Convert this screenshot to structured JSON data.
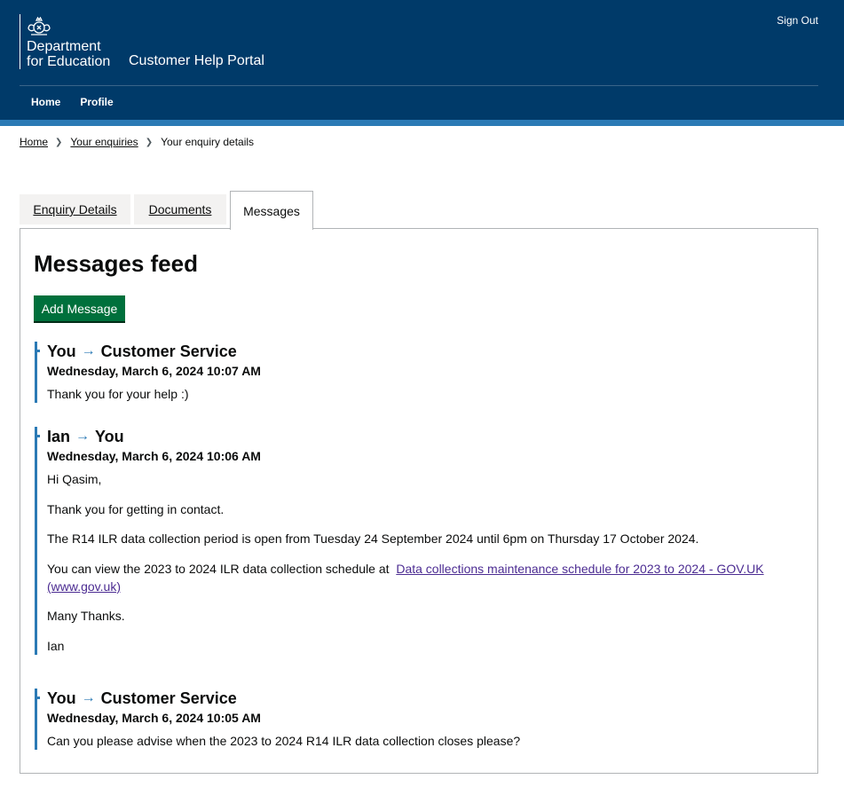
{
  "header": {
    "department_name": "Department\nfor Education",
    "portal_name": "Customer Help Portal",
    "sign_out": "Sign Out",
    "nav": [
      "Home",
      "Profile"
    ]
  },
  "breadcrumb": {
    "home": "Home",
    "enquiries": "Your enquiries",
    "current": "Your enquiry details"
  },
  "tabs": {
    "enquiry_details": "Enquiry Details",
    "documents": "Documents",
    "messages": "Messages"
  },
  "feed": {
    "title": "Messages feed",
    "add_button": "Add Message"
  },
  "messages": [
    {
      "from": "You",
      "to": "Customer Service",
      "date": "Wednesday, March 6, 2024 10:07 AM",
      "body": [
        "Thank you for your help :)"
      ]
    },
    {
      "from": "Ian",
      "to": "You",
      "date": "Wednesday, March 6, 2024 10:06 AM",
      "body": [
        "Hi Qasim,",
        "Thank you for getting in contact.",
        "The R14 ILR data collection period is open from Tuesday 24 September 2024 until 6pm on Thursday 17 October 2024.",
        "You can view the 2023 to 2024 ILR data collection schedule at",
        "Many Thanks.",
        "Ian"
      ],
      "link_text": "Data collections maintenance schedule for 2023 to 2024 - GOV.UK (www.gov.uk)"
    },
    {
      "from": "You",
      "to": "Customer Service",
      "date": "Wednesday, March 6, 2024 10:05 AM",
      "body": [
        "Can you please advise when the 2023 to 2024 R14 ILR data collection closes please?"
      ]
    }
  ],
  "colors": {
    "header_bg": "#003a69",
    "accent_bar": "#2b7ab5",
    "button_green": "#00703c",
    "link_purple": "#4c2c92"
  },
  "icons": {
    "crest": "royal-coat-of-arms-icon",
    "arrow": "right-arrow-icon",
    "separator": "chevron-right-icon"
  }
}
